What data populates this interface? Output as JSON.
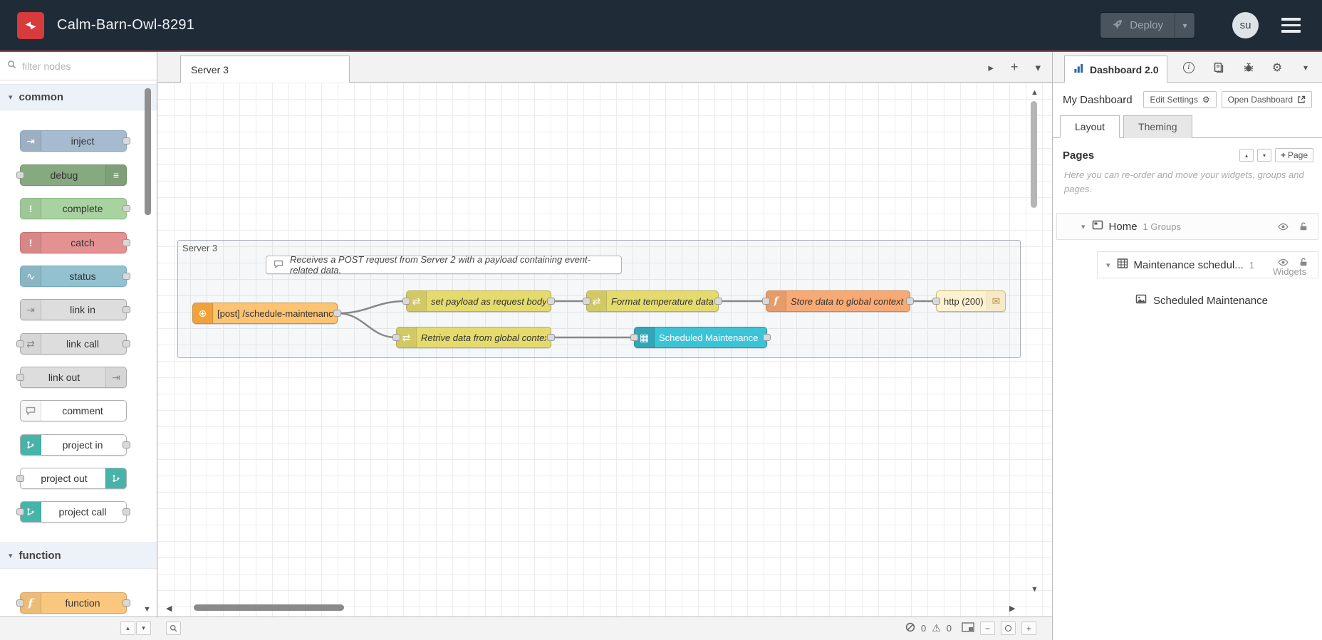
{
  "header": {
    "title": "Calm-Barn-Owl-8291",
    "deploy_label": "Deploy",
    "user_initials": "su"
  },
  "palette": {
    "search_placeholder": "filter nodes",
    "categories": [
      {
        "label": "common",
        "nodes": [
          {
            "label": "inject",
            "icon": "⇥"
          },
          {
            "label": "debug",
            "icon": "≡"
          },
          {
            "label": "complete",
            "icon": "!"
          },
          {
            "label": "catch",
            "icon": "!"
          },
          {
            "label": "status",
            "icon": "∿"
          },
          {
            "label": "link in",
            "icon": "⇥"
          },
          {
            "label": "link call",
            "icon": "⇄"
          },
          {
            "label": "link out",
            "icon": "⇥"
          },
          {
            "label": "comment"
          },
          {
            "label": "project in"
          },
          {
            "label": "project out"
          },
          {
            "label": "project call"
          }
        ]
      },
      {
        "label": "function",
        "nodes": [
          {
            "label": "function",
            "icon": "f"
          }
        ]
      }
    ]
  },
  "workspace": {
    "tab_label": "Server 3",
    "group_label": "Server 3",
    "comment_text": "Receives a POST request from Server 2 with a payload containing event-related data.",
    "nodes": [
      {
        "label": "[post] /schedule-maintenance",
        "icon": "⊕"
      },
      {
        "label": "set payload as request body",
        "icon": "⇄"
      },
      {
        "label": "Format temperature data.",
        "icon": "⇄"
      },
      {
        "label": "Store data to global context",
        "icon": "f"
      },
      {
        "label": "http (200)",
        "icon": "✉"
      },
      {
        "label": "Retrive data from global context",
        "icon": "⇄"
      },
      {
        "label": "Scheduled Maintenance",
        "icon": "▦"
      }
    ]
  },
  "sidebar": {
    "tab_label": "Dashboard 2.0",
    "dashboard_name": "My Dashboard",
    "edit_settings_label": "Edit Settings",
    "open_dashboard_label": "Open Dashboard",
    "tabs": [
      {
        "label": "Layout"
      },
      {
        "label": "Theming"
      }
    ],
    "pages_title": "Pages",
    "add_page_label": "Page",
    "help_text": "Here you can re-order and move your widgets, groups and pages.",
    "tree": {
      "page_label": "Home",
      "page_meta": "1 Groups",
      "group_label": "Maintenance schedul...",
      "group_meta_count": "1",
      "group_meta_word": "Widgets",
      "widget_label": "Scheduled Maintenance"
    }
  },
  "footer": {
    "error_count": "0",
    "warning_count": "0"
  },
  "icons": {
    "chevron_down": "▾",
    "caret_down": "▾",
    "caret_up": "▴",
    "plus": "+",
    "minus": "−",
    "scroll_right": "▸",
    "arrow_left": "◀",
    "arrow_right": "▶",
    "arrow_up": "▲",
    "arrow_down": "▼",
    "gear": "⚙",
    "warning": "⚠"
  },
  "colors": {
    "header_bg": "#202b38",
    "brand_red": "#d73b3b",
    "deploy_underline": "#b33c3c",
    "node_inject": "#a6bbcf",
    "node_debug": "#87a980",
    "node_complete": "#a8d3a0",
    "node_catch": "#e49191",
    "node_status": "#94c1d0",
    "node_link": "#dddddd",
    "node_function": "#f9c87e",
    "node_change": "#e5db6d",
    "node_http_in": "#fcc372",
    "node_http_response": "#fdf2cf",
    "node_ui_table": "#3bc4d8",
    "project_accent": "#47b4a9",
    "dashboard_icon_blue": "#3465a4"
  }
}
